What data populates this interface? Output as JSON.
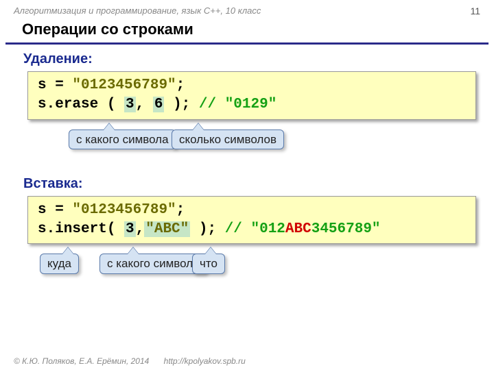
{
  "header": {
    "course": "Алгоритмизация и программирование, язык С++, 10 класс",
    "page": "11"
  },
  "title": "Операции со строками",
  "erase": {
    "label": "Удаление:",
    "line1_a": "s = ",
    "line1_str": "\"0123456789\"",
    "line1_b": ";",
    "line2_a": "s.erase ( ",
    "arg1": "3",
    "sep": ", ",
    "arg2": "6",
    "line2_b": " ); ",
    "comment": "// \"0129\"",
    "call1": "с какого\nсимвола",
    "call2": "сколько\nсимволов"
  },
  "insert": {
    "label": "Вставка:",
    "line1_a": "s = ",
    "line1_str": "\"0123456789\"",
    "line1_b": ";",
    "line2_a": "s.insert( ",
    "arg1": "3",
    "sep": ",",
    "arg2": "\"ABC\"",
    "line2_b": " ); ",
    "comment_a": "// \"012",
    "comment_red": "ABC",
    "comment_b": "3456789\"",
    "call1": "куда",
    "call2": "с какого\nсимвола",
    "call3": "что"
  },
  "footer": {
    "copyright": "© К.Ю. Поляков, Е.А. Ерёмин, 2014",
    "url": "http://kpolyakov.spb.ru"
  }
}
